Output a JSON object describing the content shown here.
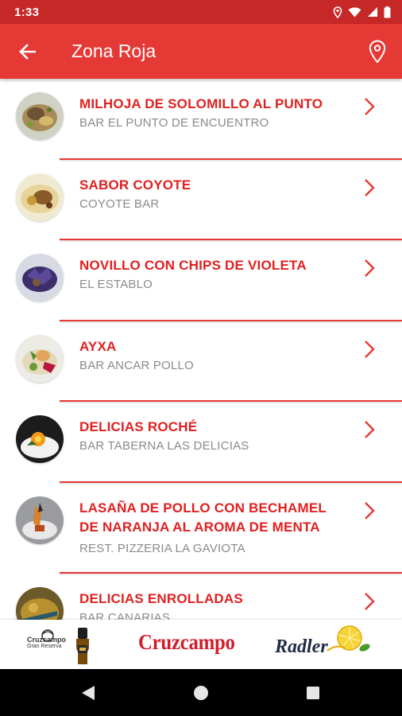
{
  "status": {
    "time": "1:33"
  },
  "appbar": {
    "title": "Zona Roja"
  },
  "items": [
    {
      "title": "MILHOJA DE SOLOMILLO AL PUNTO",
      "subtitle": "BAR EL PUNTO DE ENCUENTRO"
    },
    {
      "title": "SABOR COYOTE",
      "subtitle": "COYOTE BAR"
    },
    {
      "title": "NOVILLO CON CHIPS DE VIOLETA",
      "subtitle": "EL ESTABLO"
    },
    {
      "title": "AYXA",
      "subtitle": "BAR ANCAR POLLO"
    },
    {
      "title": "DELICIAS ROCHÉ",
      "subtitle": "BAR TABERNA LAS DELICIAS"
    },
    {
      "title": "LASAÑA DE POLLO CON BECHAMEL DE NARANJA AL AROMA DE MENTA",
      "subtitle": "REST. PIZZERIA LA GAVIOTA"
    },
    {
      "title": "DELICIAS ENROLLADAS",
      "subtitle": "BAR CANARIAS"
    }
  ],
  "sponsors": {
    "left": "Cruzcampo",
    "left_sub": "Gran Reserva",
    "center": "Cruzcampo",
    "right": "Radler"
  },
  "colors": {
    "primary": "#e53935",
    "status_bar": "#c62828",
    "title_text": "#e02020",
    "subtitle_text": "#8a8a8a"
  }
}
